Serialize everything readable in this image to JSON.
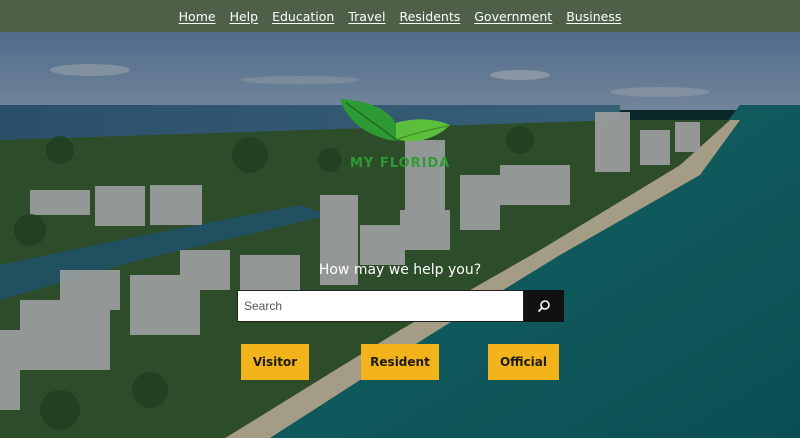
{
  "nav": {
    "items": [
      {
        "label": "Home"
      },
      {
        "label": "Help"
      },
      {
        "label": "Education"
      },
      {
        "label": "Travel"
      },
      {
        "label": "Residents"
      },
      {
        "label": "Government"
      },
      {
        "label": "Business"
      }
    ]
  },
  "logo": {
    "text": "MY FLORIDA",
    "icon": "leaf-icon"
  },
  "hero": {
    "prompt": "How may we help you?"
  },
  "search": {
    "placeholder": "Search",
    "value": "",
    "button_icon": "search-icon"
  },
  "buttons": {
    "visitor": "Visitor",
    "resident": "Resident",
    "official": "Official"
  },
  "colors": {
    "nav_bg": "#4e6148",
    "accent": "#f2b31b",
    "logo_green": "#2e9a34"
  }
}
